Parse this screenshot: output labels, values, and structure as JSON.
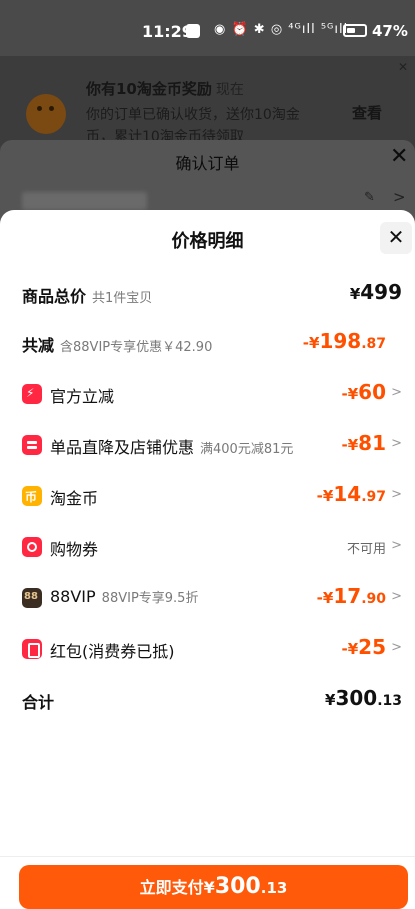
{
  "status_bar": {
    "time": "11:29",
    "icons_text": "◉ ⏰ ✱ ◎ ⁴ᴳıll ⁵ᴳıll",
    "battery_level": 0.47,
    "battery": "47%"
  },
  "notification": {
    "title": "你有10淘金币奖励",
    "time": "现在",
    "body": "你的订单已确认收货，送你10淘金币，累计10淘金币待领取",
    "action": "查看",
    "close": "✕"
  },
  "confirm_order": {
    "title": "确认订单",
    "close": "✕",
    "edit_icon": "✎",
    "arrow": ">"
  },
  "price_detail": {
    "title": "价格明细",
    "close": "✕",
    "rows": [
      {
        "label": "商品总价",
        "sub": "共1件宝贝",
        "sign": "¥",
        "int": "499",
        "dec": ""
      },
      {
        "label": "共减",
        "sub": "含88VIP专享优惠￥42.90",
        "sign": "-¥",
        "int": "198",
        "dec": ".87"
      },
      {
        "label": "官方立减",
        "sub": "",
        "sign": "-¥",
        "int": "60",
        "dec": "",
        "chev": ">"
      },
      {
        "label": "单品直降及店铺优惠",
        "sub": "满400元减81元",
        "sign": "-¥",
        "int": "81",
        "dec": "",
        "chev": ">"
      },
      {
        "label": "淘金币",
        "sub": "",
        "sign": "-¥",
        "int": "14",
        "dec": ".97",
        "chev": ">"
      },
      {
        "label": "购物券",
        "sub": "",
        "value": "不可用",
        "chev": ">"
      },
      {
        "label": "88VIP",
        "sub": "88VIP专享9.5折",
        "sign": "-¥",
        "int": "17",
        "dec": ".90",
        "chev": ">"
      },
      {
        "label": "红包(消费券已抵)",
        "sub": "",
        "sign": "-¥",
        "int": "25",
        "dec": "",
        "chev": ">"
      },
      {
        "label": "合计",
        "sub": "",
        "sign": "¥",
        "int": "300",
        "dec": ".13"
      }
    ],
    "icons": [
      "lightning-icon",
      "shop-icon",
      "coin-icon",
      "voucher-icon",
      "88vip-icon",
      "hongbao-icon"
    ]
  },
  "pay_button": {
    "label": "立即支付",
    "sign": "¥",
    "int": "300",
    "dec": ".13"
  },
  "colors": {
    "accent": "#ff5000",
    "pay_button": "#ff5a0a",
    "icon_red": "#ff2741",
    "icon_yellow": "#ffb200"
  }
}
